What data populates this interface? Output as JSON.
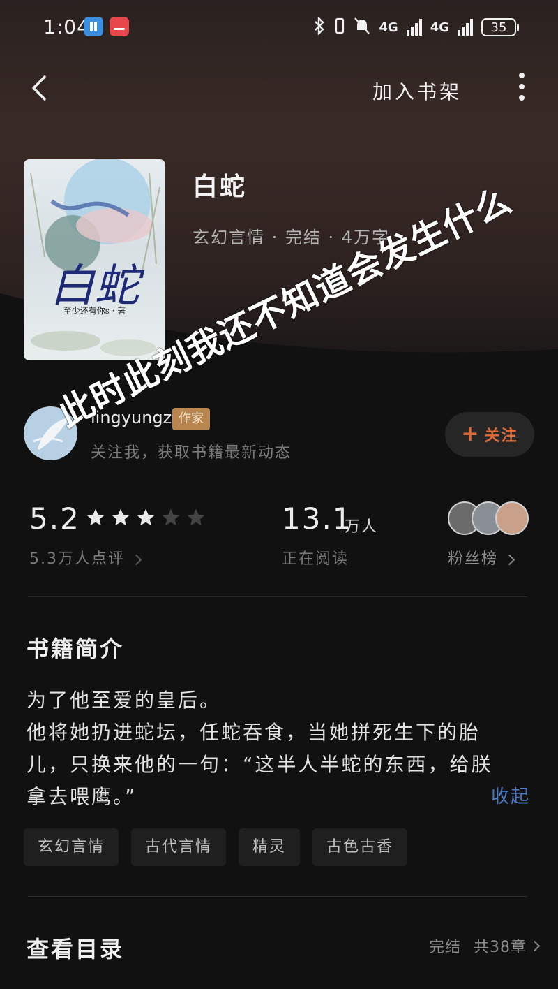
{
  "status_bar": {
    "time": "1:04",
    "network": "4G",
    "battery": "35"
  },
  "header": {
    "add_to_shelf": "加入书架"
  },
  "book": {
    "cover_title": "白蛇",
    "cover_author": "至少还有你s · 著",
    "title": "白蛇",
    "meta": "玄幻言情 · 完结 · 4万字"
  },
  "author": {
    "name": "lingyungzs",
    "tag": "作家",
    "subtitle": "关注我，获取书籍最新动态",
    "follow_label": "关注"
  },
  "stats": {
    "rating": "5.2",
    "stars_filled": 3,
    "stars_total": 5,
    "rating_count": "5.3万人点评",
    "readers": "13.1",
    "readers_unit": "万人",
    "readers_label": "正在阅读",
    "fans_label": "粉丝榜"
  },
  "intro": {
    "title": "书籍简介",
    "line1": "为了他至爱的皇后。",
    "line2": "他将她扔进蛇坛，任蛇吞食，当她拼死生下的胎儿，只换来他的一句：“这半人半蛇的东西，给朕拿去喂鹰。”",
    "collapse": "收起"
  },
  "tags": [
    "玄幻言情",
    "古代言情",
    "精灵",
    "古色古香"
  ],
  "toc": {
    "title": "查看目录",
    "status": "完结",
    "chapters": "共38章"
  },
  "watermark": "此时此刻我还不知道会发生什么",
  "colors": {
    "accent_follow": "#e26a36",
    "link_blue": "#4f78c2",
    "tag_gold": "#b8864e",
    "background": "#111111"
  }
}
